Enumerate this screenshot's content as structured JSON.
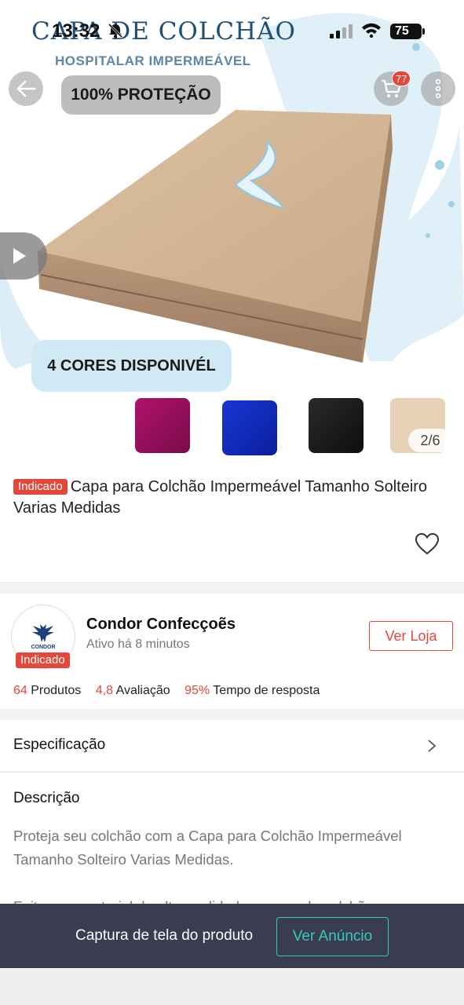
{
  "status_bar": {
    "time": "13:32",
    "battery": "75"
  },
  "hero": {
    "title": "CAPA DE COLCHÃO",
    "subtitle": "HOSPITALAR IMPERMEÁVEL",
    "protection_badge": "100% PROTEÇÃO",
    "colors_badge": "4 CORES DISPONIVÉL",
    "swatch_colors": [
      "#9e0f5f",
      "#1530c4",
      "#1a1a1a",
      "#e8d2b6"
    ],
    "page_indicator": "2/6",
    "cart_count": "77"
  },
  "product": {
    "tag": "Indicado",
    "title": "Capa para Colchão Impermeável Tamanho Solteiro Varias Medidas"
  },
  "store": {
    "logo_text": "CONDOR",
    "tag": "Indicado",
    "name": "Condor Confecçoẽs",
    "active": "Ativo há 8 minutos",
    "visit_button": "Ver Loja",
    "stats": {
      "products_value": "64",
      "products_label": "Produtos",
      "rating_value": "4,8",
      "rating_label": "Avaliação",
      "response_value": "95%",
      "response_label": "Tempo de resposta"
    }
  },
  "specification": {
    "label": "Especificação"
  },
  "description": {
    "label": "Descrição",
    "text": "Proteja seu colchão com a Capa para Colchão Impermeável Tamanho Solteiro Varias Medidas.",
    "text_partial": "Feita com material de alta qualidade, a capa de colchão"
  },
  "bottom_banner": {
    "label": "Captura de tela do produto",
    "button": "Ver Anúncio"
  },
  "colors": {
    "accent": "#e5483a",
    "teal": "#38c9bf",
    "banner_bg": "#3a3d4f"
  }
}
